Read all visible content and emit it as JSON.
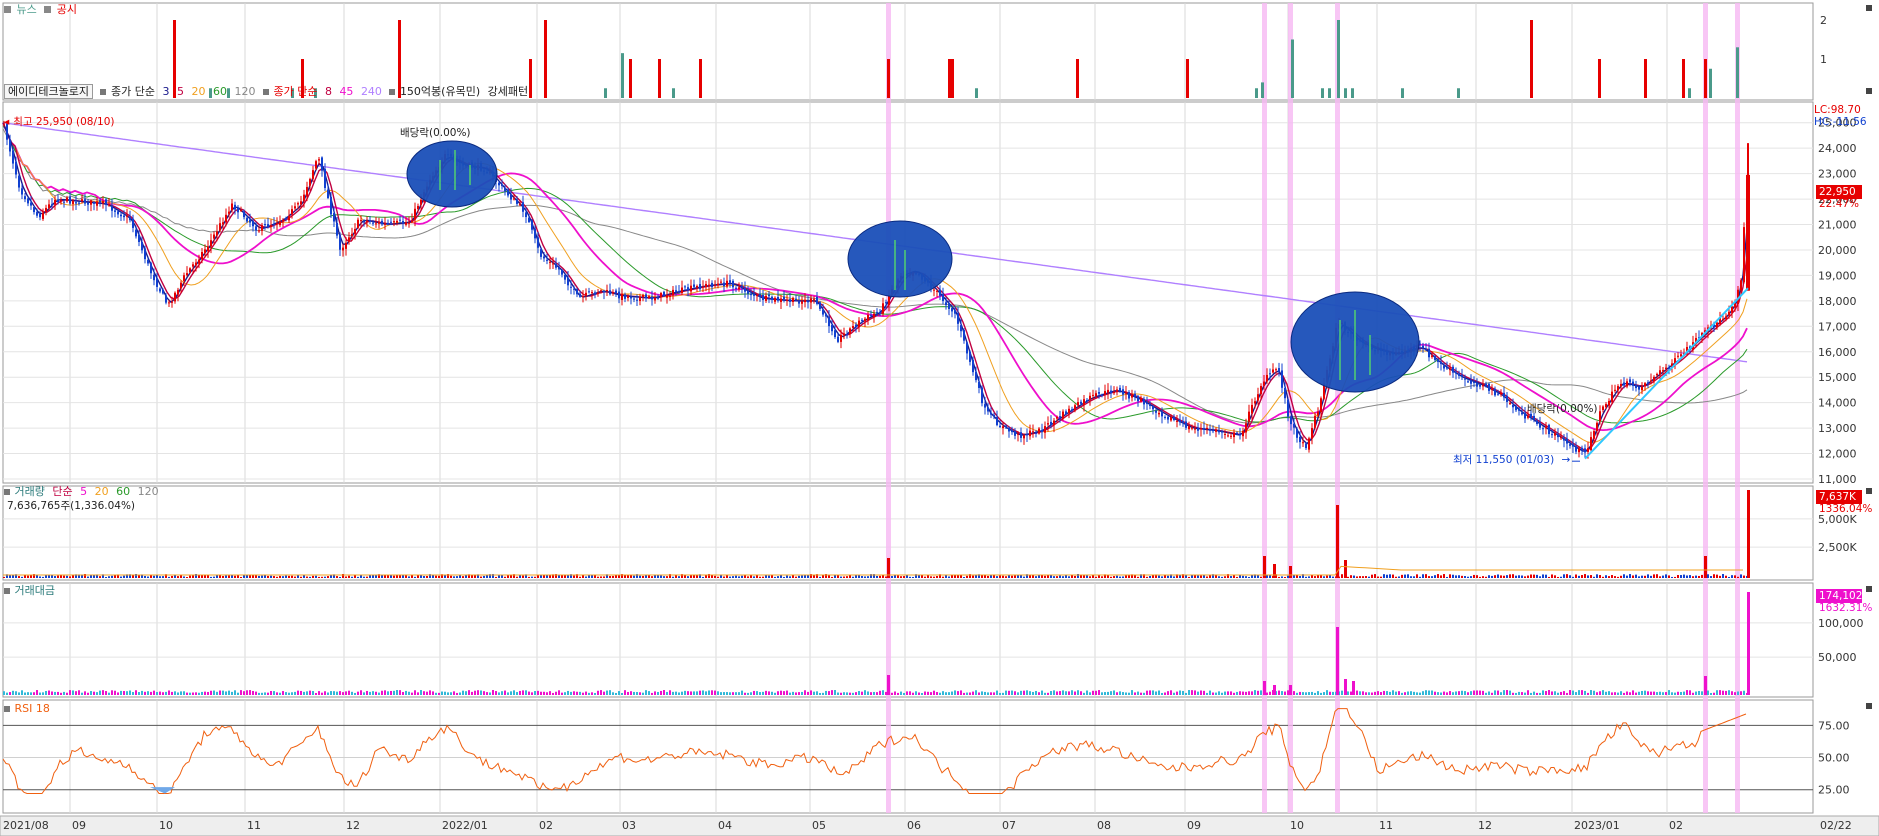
{
  "news_panel": {
    "legend": {
      "news": "뉴스",
      "disclosure": "공시"
    },
    "y_ticks": [
      "2",
      "1"
    ],
    "colors": {
      "news": "#4a9a8a",
      "disclosure": "#e60000"
    }
  },
  "price_panel": {
    "legend": {
      "stock_name": "에이디테크놀로지",
      "ma_close_label": "종가 단순",
      "ma_close_periods": [
        "3",
        "5",
        "20",
        "60",
        "120"
      ],
      "ma_close2_label": "종가 단순",
      "ma_close2_periods": [
        "8",
        "45",
        "240"
      ],
      "indicator": "150억봉(유목민)",
      "pattern": "강세패턴"
    },
    "high_label": "최고 25,950 (08/10)",
    "low_label": "최저 11,550 (01/03)",
    "dividend_label": "배당락(0.00%)",
    "lc": "LC:98.70",
    "hc": "HC:-11.56",
    "current_price": "22,950",
    "current_change": "22.47%",
    "y_ticks": [
      "25,000",
      "24,000",
      "23,000",
      "22,000",
      "21,000",
      "20,000",
      "19,000",
      "18,000",
      "17,000",
      "16,000",
      "15,000",
      "14,000",
      "13,000",
      "12,000",
      "11,000"
    ],
    "colors": {
      "up": "#e60000",
      "down": "#1040d0",
      "ma3": "#1a1a8c",
      "ma5": "#c00040",
      "ma20": "#f0a020",
      "ma60": "#2a9a2a",
      "ma120": "#888888",
      "ma45": "#ee10cc",
      "ma240": "#b080ff",
      "circle": "#1a4fb8"
    }
  },
  "volume_panel": {
    "legend": {
      "title": "거래량",
      "ma_label": "단순",
      "periods": [
        "5",
        "20",
        "60",
        "120"
      ]
    },
    "value_label": "7,636,765주(1,336.04%)",
    "current_value": "7,637K",
    "current_change": "1336.04%",
    "y_ticks": [
      "5,000K",
      "2,500K"
    ]
  },
  "amount_panel": {
    "legend": {
      "title": "거래대금"
    },
    "current_value": "174,102",
    "current_change": "1632.31%",
    "y_ticks": [
      "100,000",
      "50,000"
    ]
  },
  "rsi_panel": {
    "legend": {
      "title": "RSI 18"
    },
    "y_ticks": [
      "75.00",
      "50.00",
      "25.00"
    ]
  },
  "x_axis": {
    "labels": [
      "2021/08",
      "09",
      "10",
      "11",
      "12",
      "2022/01",
      "02",
      "03",
      "04",
      "05",
      "06",
      "07",
      "08",
      "09",
      "10",
      "11",
      "12",
      "2023/01",
      "02",
      "02/22"
    ]
  },
  "chart_data": {
    "type": "candlestick",
    "title": "에이디테크놀로지",
    "x_range": [
      "2021/08",
      "2023/02/22"
    ],
    "ylim": [
      11000,
      25500
    ],
    "price_path": [
      {
        "x": "2021/08",
        "y": 25000
      },
      {
        "x": "2021/08 mid",
        "y": 22000
      },
      {
        "x": "2021/09",
        "y": 22000
      },
      {
        "x": "2021/09 late",
        "y": 21500
      },
      {
        "x": "2021/10",
        "y": 17800
      },
      {
        "x": "2021/10 mid",
        "y": 19500
      },
      {
        "x": "2021/11",
        "y": 22000
      },
      {
        "x": "2021/11 mid",
        "y": 20500
      },
      {
        "x": "2021/11 late",
        "y": 23700
      },
      {
        "x": "2021/12",
        "y": 19800
      },
      {
        "x": "2021/12 mid",
        "y": 21000
      },
      {
        "x": "2021/12 late",
        "y": 21000
      },
      {
        "x": "2022/01",
        "y": 23600
      },
      {
        "x": "2022/01 mid",
        "y": 23200
      },
      {
        "x": "2022/02",
        "y": 20000
      },
      {
        "x": "2022/02 mid",
        "y": 18000
      },
      {
        "x": "2022/03",
        "y": 18300
      },
      {
        "x": "2022/04",
        "y": 18900
      },
      {
        "x": "2022/05",
        "y": 17900
      },
      {
        "x": "2022/05 late",
        "y": 16300
      },
      {
        "x": "2022/06",
        "y": 19500
      },
      {
        "x": "2022/06 mid",
        "y": 17500
      },
      {
        "x": "2022/07",
        "y": 13000
      },
      {
        "x": "2022/07 mid",
        "y": 12500
      },
      {
        "x": "2022/08",
        "y": 14200
      },
      {
        "x": "2022/09",
        "y": 12800
      },
      {
        "x": "2022/09 late",
        "y": 15500
      },
      {
        "x": "2022/10",
        "y": 12000
      },
      {
        "x": "2022/10 mid",
        "y": 17500
      },
      {
        "x": "2022/11",
        "y": 16200
      },
      {
        "x": "2022/12",
        "y": 14800
      },
      {
        "x": "2022/12 late",
        "y": 12500
      },
      {
        "x": "2023/01",
        "y": 11900
      },
      {
        "x": "2023/01 late",
        "y": 15000
      },
      {
        "x": "2023/02",
        "y": 16000
      },
      {
        "x": "2023/02/22",
        "y": 22950
      }
    ],
    "ma_240_path": [
      {
        "x": "2021/08",
        "y": 25000
      },
      {
        "x": "2022/01",
        "y": 23700
      },
      {
        "x": "2022/06",
        "y": 21000
      },
      {
        "x": "2022/10",
        "y": 17800
      },
      {
        "x": "2023/01",
        "y": 15500
      },
      {
        "x": "2023/02/22",
        "y": 15500
      }
    ]
  }
}
